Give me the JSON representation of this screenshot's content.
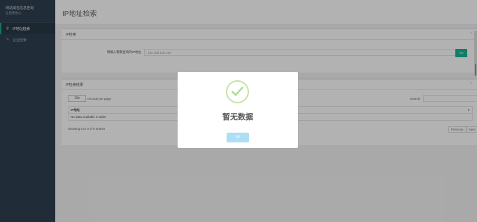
{
  "sidebar": {
    "title": "网站域名信息查询",
    "subtitle": "让您更省心",
    "items": [
      {
        "label": "IP地址检索",
        "icon": "search-icon",
        "active": true
      },
      {
        "label": "企业检索",
        "icon": "pencil-icon",
        "active": false
      }
    ]
  },
  "header": {
    "title": "IP地址检索"
  },
  "search_panel": {
    "title": "IP检索",
    "field_label": "请输入需要查询的IP地址",
    "field_value": "192.168.100.100",
    "button_label": "Go"
  },
  "result_panel": {
    "title": "IP检索结果",
    "length_value": "10",
    "length_suffix": "records per page",
    "search_label": "Search:",
    "columns": [
      "IP地址",
      "域名数"
    ],
    "empty_text": "No data available in table",
    "info": "Showing 0 to 0 of 0 entries",
    "prev": "Previous",
    "next": "Next"
  },
  "dialog": {
    "title": "暂无数据",
    "ok_label": "OK",
    "check_color": "#a5dc86"
  }
}
